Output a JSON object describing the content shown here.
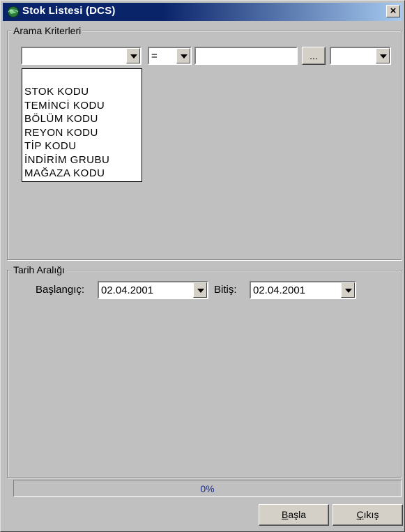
{
  "window": {
    "title": "Stok Listesi (DCS)",
    "close_label": "×"
  },
  "search_criteria": {
    "group_label": "Arama Kriterleri",
    "field_combo_value": "",
    "operator_combo_value": "=",
    "value_input": "",
    "browse_button_label": "...",
    "extra_combo_value": "",
    "field_options": [
      "STOK KODU",
      "TEMİNCİ KODU",
      "BÖLÜM KODU",
      "REYON KODU",
      "TİP KODU",
      "İNDİRİM GRUBU",
      "MAĞAZA KODU"
    ]
  },
  "date_range": {
    "group_label": "Tarih Aralığı",
    "start_label": "Başlangıç:",
    "start_value": "02.04.2001",
    "end_label": "Bitiş:",
    "end_value": "02.04.2001"
  },
  "progress": {
    "text": "0%",
    "value": 0
  },
  "buttons": {
    "start_accel": "B",
    "start_rest": "aşla",
    "exit_accel": "Ç",
    "exit_rest": "ıkış"
  },
  "colors": {
    "titlebar_start": "#0a246a",
    "titlebar_end": "#a6caf0",
    "face": "#c0c0c0"
  }
}
